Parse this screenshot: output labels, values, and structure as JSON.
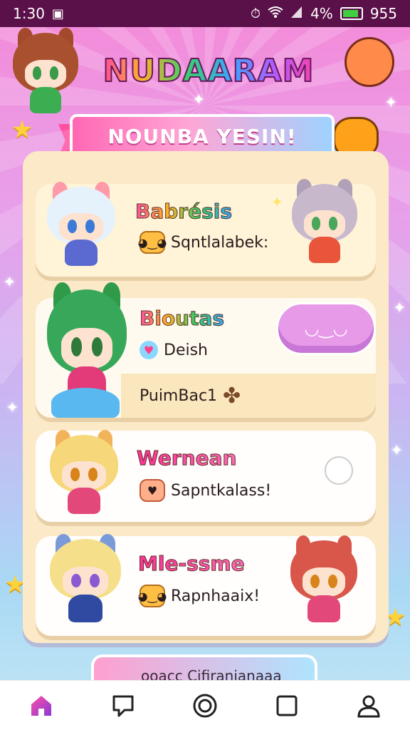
{
  "status_bar": {
    "time": "1:30",
    "notification_icon": "image-icon",
    "right_icons": [
      "alarm-icon",
      "wifi-icon",
      "signal-icon"
    ],
    "battery_percent": "4%",
    "battery_level": 0.9,
    "extra": "955"
  },
  "app": {
    "title": "NUDAARAM",
    "banner": "NOUNBA  YESIN!"
  },
  "cards": [
    {
      "title": "Babrésis",
      "line_icon": "smiley-badge-icon",
      "line_text": "Sqntlalabek:"
    },
    {
      "title": "Bioutas",
      "line_icon": "heart-icon",
      "line_text": "Deish",
      "sub_text": "PuimBac1",
      "sub_icon": "chocolate-icon"
    },
    {
      "title": "Wernean",
      "line_icon": "heart-badge-icon",
      "line_text": "Sapntkalass!"
    },
    {
      "title": "Mle-ssme",
      "line_icon": "smiley-badge-icon",
      "line_text": "Rapnhaaix!"
    }
  ],
  "peek_card": {
    "text": "ooacc Cifiranianaaa"
  },
  "bottom_nav": {
    "items": [
      {
        "icon": "home-icon",
        "active": true
      },
      {
        "icon": "chat-icon",
        "active": false
      },
      {
        "icon": "circle-icon",
        "active": false
      },
      {
        "icon": "square-icon",
        "active": false
      },
      {
        "icon": "profile-icon",
        "active": false
      }
    ]
  },
  "colors": {
    "status_bar": "#5a1048",
    "accent": "#ff4fa1",
    "panel": "#fbe9c8",
    "nav_active": "#c03ad0"
  }
}
